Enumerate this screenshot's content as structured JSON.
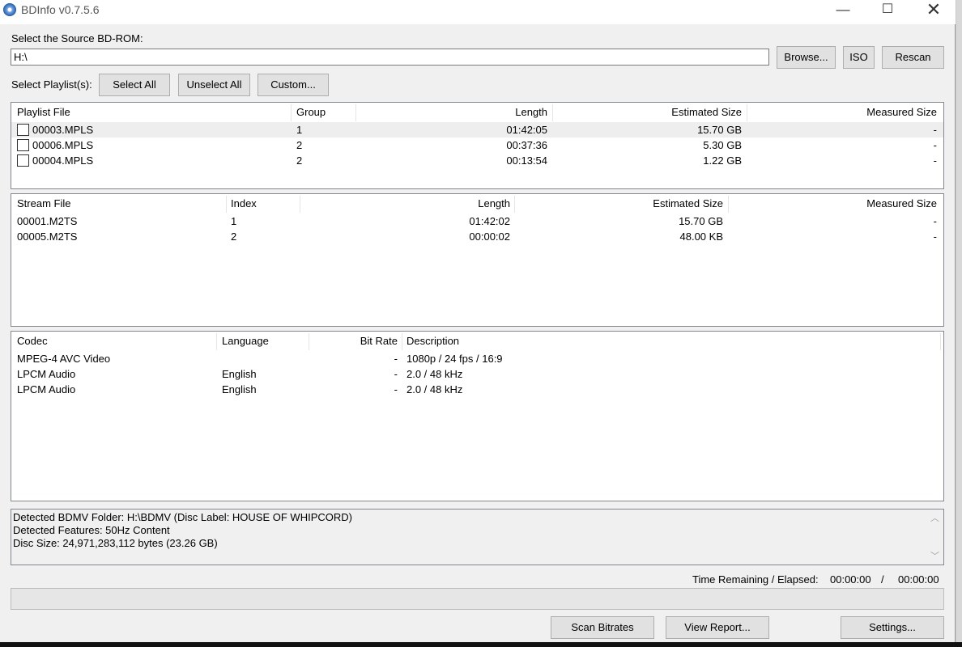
{
  "window": {
    "title": "BDInfo v0.7.5.6",
    "min_glyph": "—",
    "max_glyph": "☐",
    "close_glyph": "✕"
  },
  "source": {
    "label": "Select the Source BD-ROM:",
    "value": "H:\\",
    "browse_label": "Browse...",
    "iso_label": "ISO",
    "rescan_label": "Rescan"
  },
  "playlist_select": {
    "label": "Select Playlist(s):",
    "select_all_label": "Select All",
    "unselect_all_label": "Unselect All",
    "custom_label": "Custom..."
  },
  "playlists": {
    "columns": [
      "Playlist File",
      "Group",
      "Length",
      "Estimated Size",
      "Measured Size"
    ],
    "rows": [
      {
        "file": "00003.MPLS",
        "group": "1",
        "length": "01:42:05",
        "est": "15.70 GB",
        "meas": "-"
      },
      {
        "file": "00006.MPLS",
        "group": "2",
        "length": "00:37:36",
        "est": "5.30 GB",
        "meas": "-"
      },
      {
        "file": "00004.MPLS",
        "group": "2",
        "length": "00:13:54",
        "est": "1.22 GB",
        "meas": "-"
      }
    ]
  },
  "streams": {
    "columns": [
      "Stream File",
      "Index",
      "Length",
      "Estimated Size",
      "Measured Size"
    ],
    "rows": [
      {
        "file": "00001.M2TS",
        "index": "1",
        "length": "01:42:02",
        "est": "15.70 GB",
        "meas": "-"
      },
      {
        "file": "00005.M2TS",
        "index": "2",
        "length": "00:00:02",
        "est": "48.00 KB",
        "meas": "-"
      }
    ]
  },
  "codecs": {
    "columns": [
      "Codec",
      "Language",
      "Bit Rate",
      "Description"
    ],
    "rows": [
      {
        "codec": "MPEG-4 AVC Video",
        "lang": "",
        "bitrate": "-",
        "desc": "1080p / 24 fps / 16:9"
      },
      {
        "codec": "LPCM Audio",
        "lang": "English",
        "bitrate": "-",
        "desc": "2.0 / 48 kHz"
      },
      {
        "codec": "LPCM Audio",
        "lang": "English",
        "bitrate": "-",
        "desc": "2.0 / 48 kHz"
      }
    ]
  },
  "log": {
    "lines": [
      "Detected BDMV Folder: H:\\BDMV (Disc Label: HOUSE OF WHIPCORD)",
      "Detected Features: 50Hz Content",
      "Disc Size: 24,971,283,112 bytes (23.26 GB)"
    ]
  },
  "time": {
    "label": "Time Remaining / Elapsed:",
    "remaining": "00:00:00",
    "separator": "/",
    "elapsed": "00:00:00"
  },
  "progress": 0,
  "actions": {
    "scan_label": "Scan Bitrates",
    "report_label": "View Report...",
    "settings_label": "Settings..."
  }
}
